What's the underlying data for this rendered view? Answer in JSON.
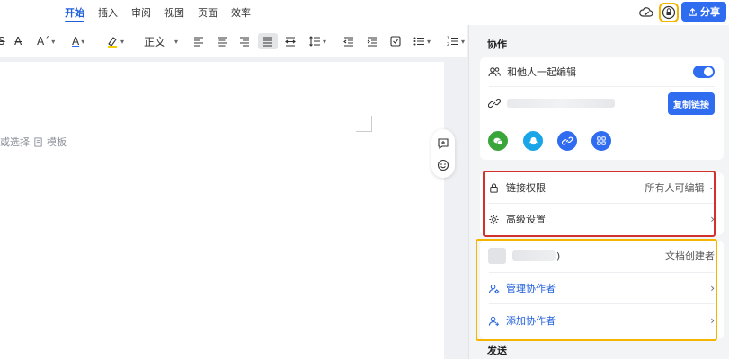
{
  "menu": {
    "items": [
      "开始",
      "插入",
      "审阅",
      "视图",
      "页面",
      "效率"
    ],
    "active_index": 0
  },
  "header": {
    "share_label": "分享"
  },
  "toolbar": {
    "font_style_label": "正文"
  },
  "document": {
    "hint_prefix": "或选择",
    "hint_template": "模板"
  },
  "panel": {
    "collab_title": "协作",
    "edit_with_others": "和他人一起编辑",
    "edit_with_others_enabled": true,
    "copy_link_button": "复制链接",
    "share_channels": [
      "wechat-icon",
      "qq-icon",
      "link-icon",
      "qrcode-icon"
    ],
    "link_permission_label": "链接权限",
    "link_permission_value": "所有人可编辑",
    "advanced_settings": "高级设置",
    "owner_suffix": ")",
    "owner_role": "文档创建者",
    "manage_collaborators": "管理协作者",
    "add_collaborators": "添加协作者",
    "send_title": "发送"
  },
  "colors": {
    "accent": "#2f6cf0",
    "highlight_red": "#d3312b",
    "highlight_yellow": "#f4b400",
    "wechat": "#3aa53a",
    "qq": "#1aa5e8"
  }
}
